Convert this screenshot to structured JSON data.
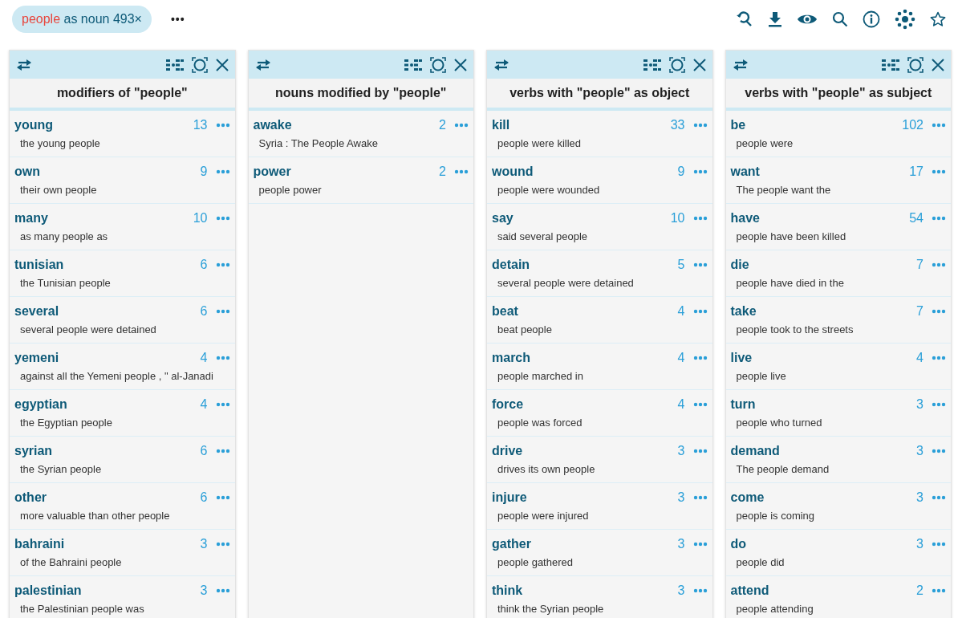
{
  "query_chip": {
    "word": "people",
    "rest": "as noun 493×"
  },
  "more_menu": "•••",
  "panels": [
    {
      "title": "modifiers of \"people\"",
      "rows": [
        {
          "word": "young",
          "count": "13",
          "example": "the young people"
        },
        {
          "word": "own",
          "count": "9",
          "example": "their own people"
        },
        {
          "word": "many",
          "count": "10",
          "example": "as many people as"
        },
        {
          "word": "tunisian",
          "count": "6",
          "example": "the Tunisian people"
        },
        {
          "word": "several",
          "count": "6",
          "example": "several people were detained"
        },
        {
          "word": "yemeni",
          "count": "4",
          "example": "against all the Yemeni people , \" al-Janadi"
        },
        {
          "word": "egyptian",
          "count": "4",
          "example": "the Egyptian people"
        },
        {
          "word": "syrian",
          "count": "6",
          "example": "the Syrian people"
        },
        {
          "word": "other",
          "count": "6",
          "example": "more valuable than other people"
        },
        {
          "word": "bahraini",
          "count": "3",
          "example": "of the Bahraini people"
        },
        {
          "word": "palestinian",
          "count": "3",
          "example": "the Palestinian people was"
        }
      ]
    },
    {
      "title": "nouns modified by \"people\"",
      "rows": [
        {
          "word": "awake",
          "count": "2",
          "example": "Syria : The People Awake"
        },
        {
          "word": "power",
          "count": "2",
          "example": "people power"
        }
      ]
    },
    {
      "title": "verbs with \"people\" as object",
      "rows": [
        {
          "word": "kill",
          "count": "33",
          "example": "people were killed"
        },
        {
          "word": "wound",
          "count": "9",
          "example": "people were wounded"
        },
        {
          "word": "say",
          "count": "10",
          "example": "said several people"
        },
        {
          "word": "detain",
          "count": "5",
          "example": "several people were detained"
        },
        {
          "word": "beat",
          "count": "4",
          "example": "beat people"
        },
        {
          "word": "march",
          "count": "4",
          "example": "people marched in"
        },
        {
          "word": "force",
          "count": "4",
          "example": "people was forced"
        },
        {
          "word": "drive",
          "count": "3",
          "example": "drives its own people"
        },
        {
          "word": "injure",
          "count": "3",
          "example": "people were injured"
        },
        {
          "word": "gather",
          "count": "3",
          "example": "people gathered"
        },
        {
          "word": "think",
          "count": "3",
          "example": "think the Syrian people"
        }
      ]
    },
    {
      "title": "verbs with \"people\" as subject",
      "rows": [
        {
          "word": "be",
          "count": "102",
          "example": "people were"
        },
        {
          "word": "want",
          "count": "17",
          "example": "The people want the"
        },
        {
          "word": "have",
          "count": "54",
          "example": "people have been killed"
        },
        {
          "word": "die",
          "count": "7",
          "example": "people have died in the"
        },
        {
          "word": "take",
          "count": "7",
          "example": "people took to the streets"
        },
        {
          "word": "live",
          "count": "4",
          "example": "people live"
        },
        {
          "word": "turn",
          "count": "3",
          "example": "people who turned"
        },
        {
          "word": "demand",
          "count": "3",
          "example": "The people demand"
        },
        {
          "word": "come",
          "count": "3",
          "example": "people is coming"
        },
        {
          "word": "do",
          "count": "3",
          "example": "people did"
        },
        {
          "word": "attend",
          "count": "2",
          "example": "people attending"
        }
      ]
    }
  ]
}
